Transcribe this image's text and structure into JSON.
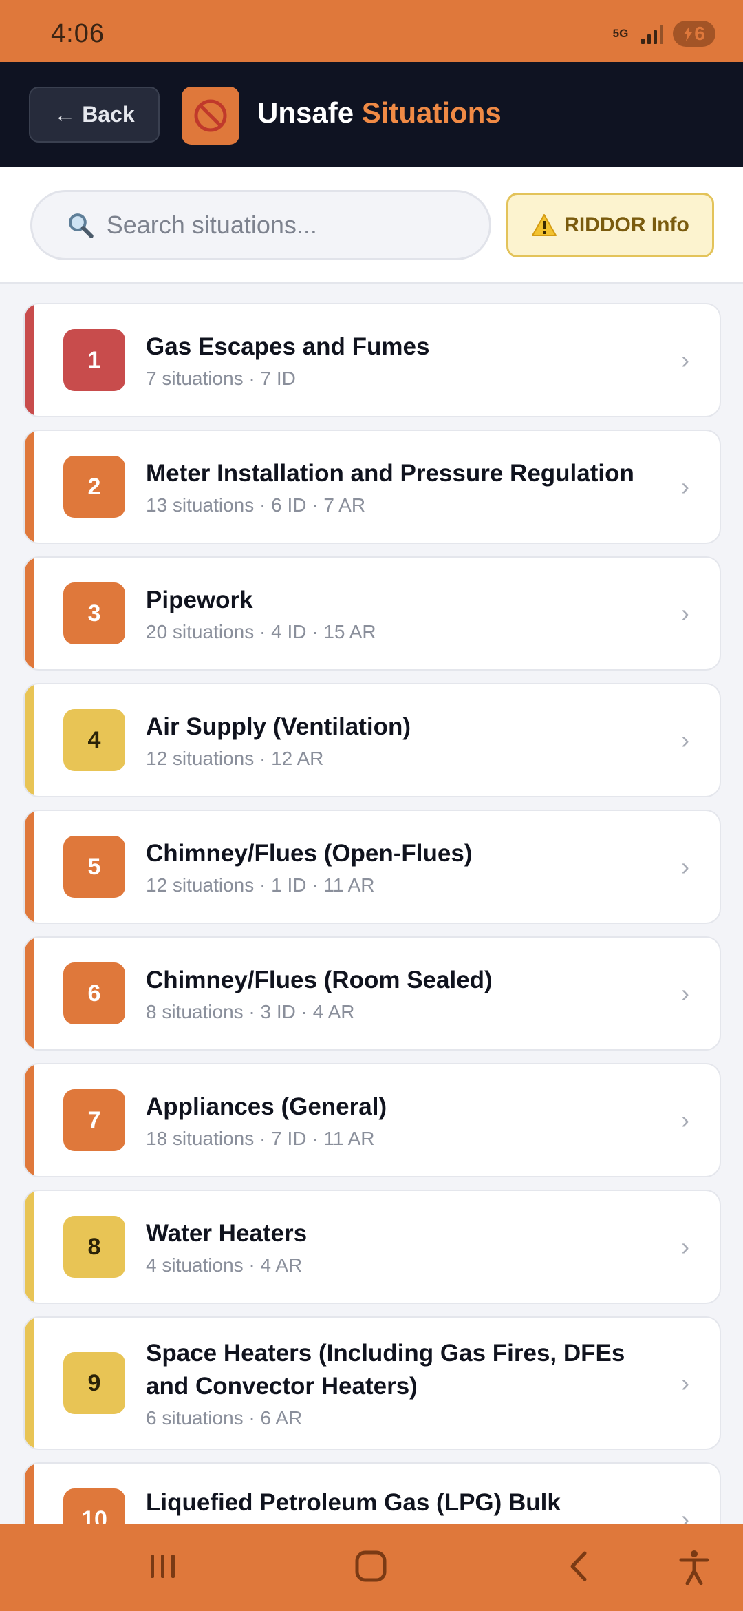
{
  "status_bar": {
    "time": "4:06",
    "network": "5G",
    "battery": "6",
    "colors": {
      "background": "#df783b"
    }
  },
  "header": {
    "back_label": "← Back",
    "logo_icon": "prohibited-icon",
    "title_main": "Unsafe ",
    "title_accent": "Situations",
    "colors": {
      "background": "#0f1322",
      "accent": "#f08a45"
    }
  },
  "search": {
    "placeholder": "Search situations...",
    "value": ""
  },
  "riddor": {
    "label": "RIDDOR Info",
    "icon": "warning-icon"
  },
  "categories": [
    {
      "number": "1",
      "title": "Gas Escapes and Fumes",
      "meta": "7 situations · 7 ID",
      "color": "#c84c4c"
    },
    {
      "number": "2",
      "title": "Meter Installation and Pressure Regulation",
      "meta": "13 situations · 6 ID · 7 AR",
      "color": "#df783b"
    },
    {
      "number": "3",
      "title": "Pipework",
      "meta": "20 situations · 4 ID · 15 AR",
      "color": "#df783b"
    },
    {
      "number": "4",
      "title": "Air Supply (Ventilation)",
      "meta": "12 situations · 12 AR",
      "color": "#e8c455"
    },
    {
      "number": "5",
      "title": "Chimney/Flues (Open-Flues)",
      "meta": "12 situations · 1 ID · 11 AR",
      "color": "#df783b"
    },
    {
      "number": "6",
      "title": "Chimney/Flues (Room Sealed)",
      "meta": "8 situations · 3 ID · 4 AR",
      "color": "#df783b"
    },
    {
      "number": "7",
      "title": "Appliances (General)",
      "meta": "18 situations · 7 ID · 11 AR",
      "color": "#df783b"
    },
    {
      "number": "8",
      "title": "Water Heaters",
      "meta": "4 situations · 4 AR",
      "color": "#e8c455"
    },
    {
      "number": "9",
      "title": "Space Heaters (Including Gas Fires, DFEs and Convector Heaters)",
      "meta": "6 situations · 6 AR",
      "color": "#e8c455"
    },
    {
      "number": "10",
      "title": "Liquefied Petroleum Gas (LPG) Bulk Storage",
      "meta": "",
      "color": "#df783b"
    }
  ],
  "nav_bar": {
    "icons": [
      "recents-icon",
      "home-icon",
      "back-icon",
      "accessibility-icon"
    ],
    "colors": {
      "background": "#df783b"
    }
  }
}
